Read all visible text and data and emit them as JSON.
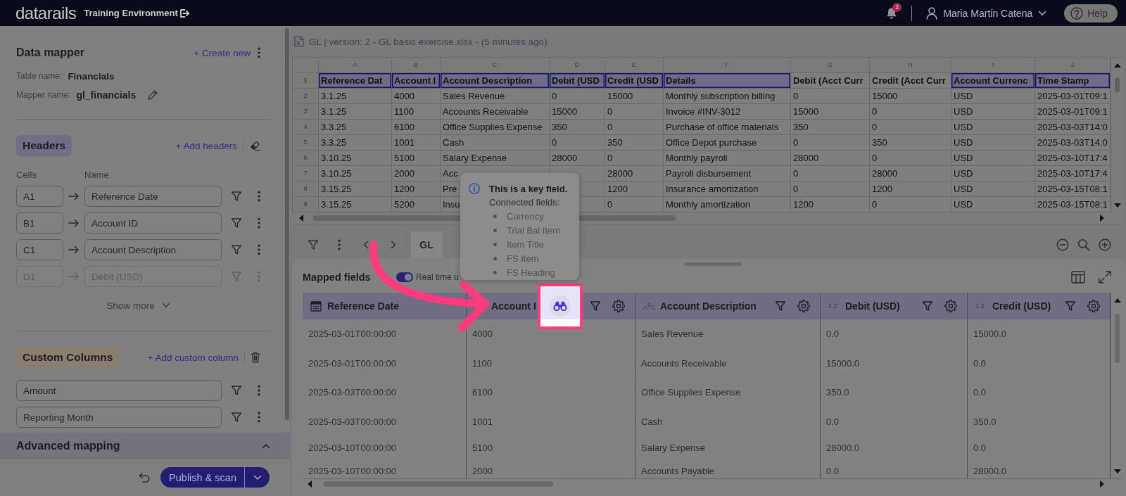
{
  "top_bar": {
    "logo": "datarails",
    "environment": "Training Environment",
    "notification_count": "2",
    "user_name": "Maria Martin Catena",
    "help": "Help"
  },
  "data_mapper": {
    "title": "Data mapper",
    "create_new": "+ Create new",
    "table_name_label": "Table name:",
    "table_name": "Financials",
    "mapper_name_label": "Mapper name:",
    "mapper_name": "gl_financials"
  },
  "headers": {
    "title": "Headers",
    "add": "+ Add headers",
    "cells_label": "Cells",
    "name_label": "Name",
    "rows": [
      {
        "cell": "A1",
        "name": "Reference Date",
        "disabled": false
      },
      {
        "cell": "B1",
        "name": "Account ID",
        "disabled": false
      },
      {
        "cell": "C1",
        "name": "Account Description",
        "disabled": false
      },
      {
        "cell": "D1",
        "name": "Debit (USD)",
        "disabled": true
      }
    ],
    "show_more": "Show more"
  },
  "custom_columns": {
    "title": "Custom Columns",
    "add": "+ Add custom column",
    "rows": [
      {
        "name": "Amount"
      },
      {
        "name": "Reporting Month"
      }
    ]
  },
  "advanced_mapping": {
    "title": "Advanced mapping"
  },
  "footer": {
    "publish": "Publish & scan"
  },
  "file_bar": {
    "title": "GL | version: 2 - GL basic exercise.xlsx - (5 minutes ago)"
  },
  "sheet": {
    "columns": [
      {
        "letter": "A",
        "mapped": true
      },
      {
        "letter": "B",
        "mapped": true
      },
      {
        "letter": "C",
        "mapped": true
      },
      {
        "letter": "D",
        "mapped": true
      },
      {
        "letter": "E",
        "mapped": true
      },
      {
        "letter": "F",
        "mapped": true
      },
      {
        "letter": "G",
        "mapped": false
      },
      {
        "letter": "H",
        "mapped": false
      },
      {
        "letter": "I",
        "mapped": true
      },
      {
        "letter": "J",
        "mapped": true
      }
    ],
    "header_row": {
      "number": "1",
      "cells": [
        "Reference Dat",
        "Account I",
        "Account Description",
        "Debit (USD",
        "Credit (USD",
        "Details",
        "Debit (Acct Curr",
        "Credit (Acct Curr",
        "Account Currenc",
        "Time Stamp"
      ]
    },
    "rows": [
      {
        "number": "2",
        "cells": [
          "3.1.25",
          "4000",
          "Sales Revenue",
          "0",
          "15000",
          "Monthly subscription billing",
          "0",
          "15000",
          "USD",
          "2025-03-01T09:1"
        ]
      },
      {
        "number": "3",
        "cells": [
          "3.1.25",
          "1100",
          "Accounts Receivable",
          "15000",
          "0",
          "Invoice #INV-3012",
          "15000",
          "0",
          "USD",
          "2025-03-01T09:1"
        ]
      },
      {
        "number": "4",
        "cells": [
          "3.3.25",
          "6100",
          "Office Supplies Expense",
          "350",
          "0",
          "Purchase of office materials",
          "350",
          "0",
          "USD",
          "2025-03-03T14:0"
        ]
      },
      {
        "number": "5",
        "cells": [
          "3.3.25",
          "1001",
          "Cash",
          "0",
          "350",
          "Office Depot purchase",
          "0",
          "350",
          "USD",
          "2025-03-03T14:0"
        ]
      },
      {
        "number": "6",
        "cells": [
          "3.10.25",
          "5100",
          "Salary Expense",
          "28000",
          "0",
          "Monthly payroll",
          "28000",
          "0",
          "USD",
          "2025-03-10T17:4"
        ]
      },
      {
        "number": "7",
        "cells": [
          "3.10.25",
          "2000",
          "Acc",
          null,
          "28000",
          "Payroll disbursement",
          "0",
          "28000",
          "USD",
          "2025-03-10T17:4"
        ]
      },
      {
        "number": "8",
        "cells": [
          "3.15.25",
          "1200",
          "Pre",
          null,
          "1200",
          "Insurance amortization",
          "0",
          "1200",
          "USD",
          "2025-03-15T08:1"
        ]
      },
      {
        "number": "9",
        "cells": [
          "3.15.25",
          "5200",
          "Insu",
          null,
          "0",
          "Monthly amortization",
          "1200",
          "0",
          "USD",
          "2025-03-15T08:1"
        ]
      }
    ]
  },
  "sheet_toolbar": {
    "tabs": [
      {
        "label": "GL",
        "selected": true
      }
    ]
  },
  "mapped_fields": {
    "title": "Mapped fields",
    "real_time": {
      "label": "Real time u",
      "on": true
    },
    "columns": [
      {
        "title": "Reference Date",
        "kind": "date",
        "filter": false,
        "settings": false
      },
      {
        "title": "Account I",
        "kind": "key",
        "filter": true,
        "settings": true
      },
      {
        "title": "Account Description",
        "kind": "text",
        "type_label": "A$^{B}$C",
        "filter": true,
        "settings": true
      },
      {
        "title": "Debit (USD)",
        "kind": "number",
        "type_label": "1.2",
        "filter": true,
        "settings": true
      },
      {
        "title": "Credit (USD)",
        "kind": "number",
        "type_label": "1.2",
        "filter": true,
        "settings": true
      }
    ],
    "rows": [
      [
        "2025-03-01T00:00:00",
        "4000",
        "Sales Revenue",
        "0.0",
        "15000.0"
      ],
      [
        "2025-03-01T00:00:00",
        "1100",
        "Accounts Receivable",
        "15000.0",
        "0.0"
      ],
      [
        "2025-03-03T00:00:00",
        "6100",
        "Office Supplies Expense",
        "350.0",
        "0.0"
      ],
      [
        "2025-03-03T00:00:00",
        "1001",
        "Cash",
        "0.0",
        "350.0"
      ],
      [
        "2025-03-10T00:00:00",
        "5100",
        "Salary Expense",
        "28000.0",
        "0.0"
      ],
      [
        "2025-03-10T00:00:00",
        "2000",
        "Accounts Payable",
        "0.0",
        "28000.0"
      ]
    ]
  },
  "tooltip": {
    "title": "This is a key field.",
    "subtitle": "Connected fields:",
    "items": [
      "Currency",
      "Trial Bal Item",
      "Item Title",
      "FS Item",
      "FS Heading"
    ]
  }
}
